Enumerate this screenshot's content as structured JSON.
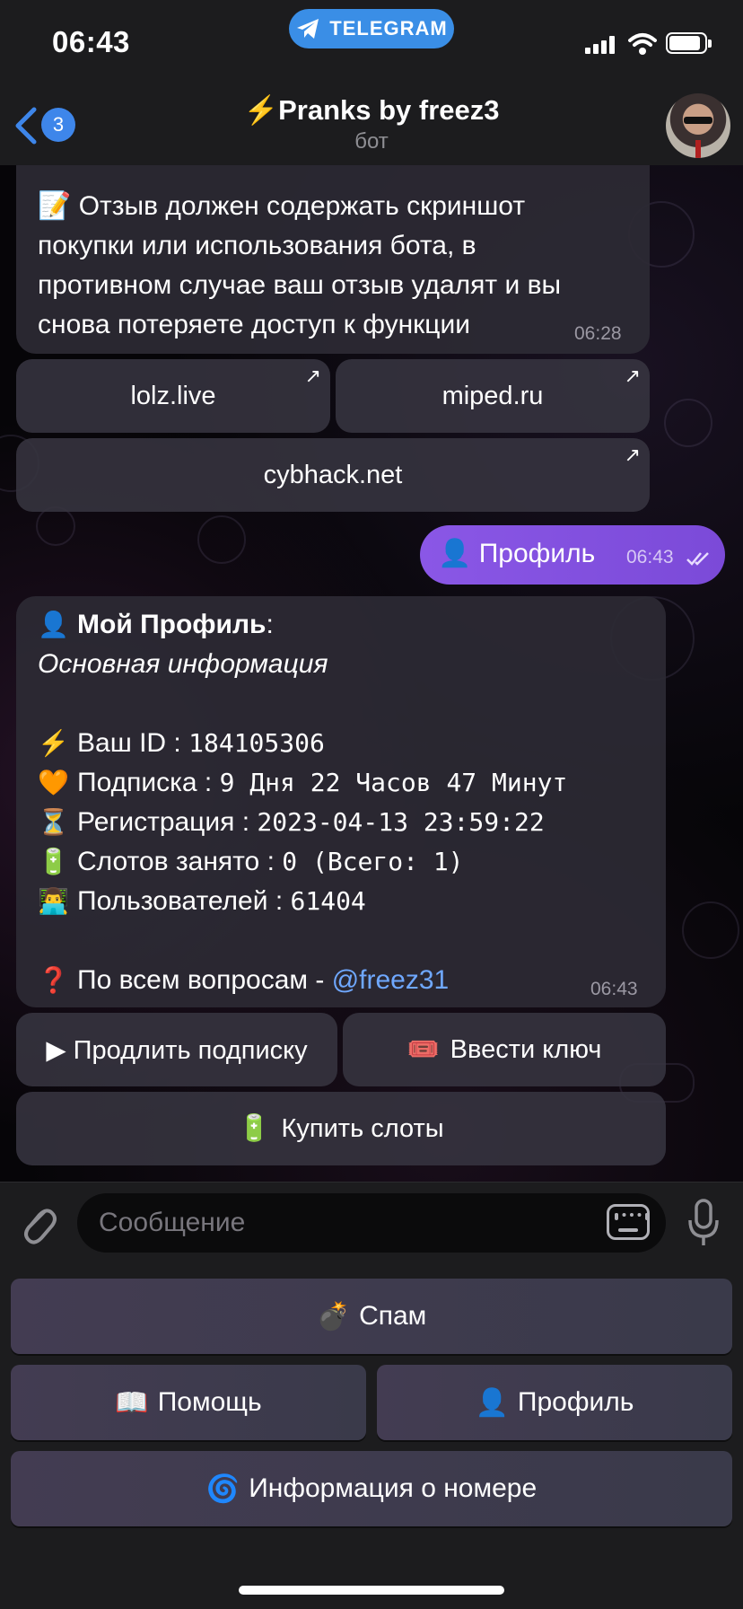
{
  "status_bar": {
    "time": "06:43",
    "pill_label": "TELEGRAM"
  },
  "header": {
    "back_badge": "3",
    "title": "⚡️Pranks by freez3",
    "subtitle": "бот"
  },
  "messages": {
    "review_notice": {
      "icon": "📝",
      "lines": [
        "Отзыв должен содержать скриншот",
        "покупки или использования бота, в",
        "противном случае ваш отзыв удалят и вы",
        "снова потеряете доступ к функции"
      ],
      "time": "06:28"
    },
    "link_buttons": [
      "lolz.live",
      "miped.ru",
      "cybhack.net"
    ],
    "outgoing": {
      "icon": "👤",
      "text": "Профиль",
      "time": "06:43"
    },
    "profile": {
      "title_icon": "👤",
      "title": "Мой Профиль",
      "title_suffix": ":",
      "subtitle": "Основная информация",
      "rows": [
        {
          "icon": "⚡️",
          "label": "Ваш ID : ",
          "value": "184105306"
        },
        {
          "icon": "🧡",
          "label": "Подписка : ",
          "value": "9 Дня 22 Часов 47 Минут"
        },
        {
          "icon": "⏳",
          "label": "Регистрация : ",
          "value": "2023-04-13 23:59:22"
        },
        {
          "icon": "🔋",
          "label": "Слотов занято : ",
          "value": "0 (Всего: 1)"
        },
        {
          "icon": "👨‍💻",
          "label": "Пользователей : ",
          "value": "61404"
        }
      ],
      "question_icon": "❓",
      "question_text": "По всем вопросам - ",
      "question_link": "@freez31",
      "time": "06:43"
    },
    "profile_buttons": {
      "extend": "▶ Продлить подписку",
      "enter_key_icon": "🎟️",
      "enter_key": "Ввести ключ",
      "buy_slots_icon": "🔋",
      "buy_slots": "Купить слоты"
    }
  },
  "input": {
    "placeholder": "Сообщение"
  },
  "keyboard": {
    "spam_icon": "💣",
    "spam": "Спам",
    "help_icon": "📖",
    "help": "Помощь",
    "profile_icon": "👤",
    "profile": "Профиль",
    "number_info_icon": "🌀",
    "number_info": "Информация о номере"
  },
  "colors": {
    "accent": "#3e86ea",
    "outgoing_bubble": "#8a57e6",
    "link": "#6fa8ff"
  }
}
